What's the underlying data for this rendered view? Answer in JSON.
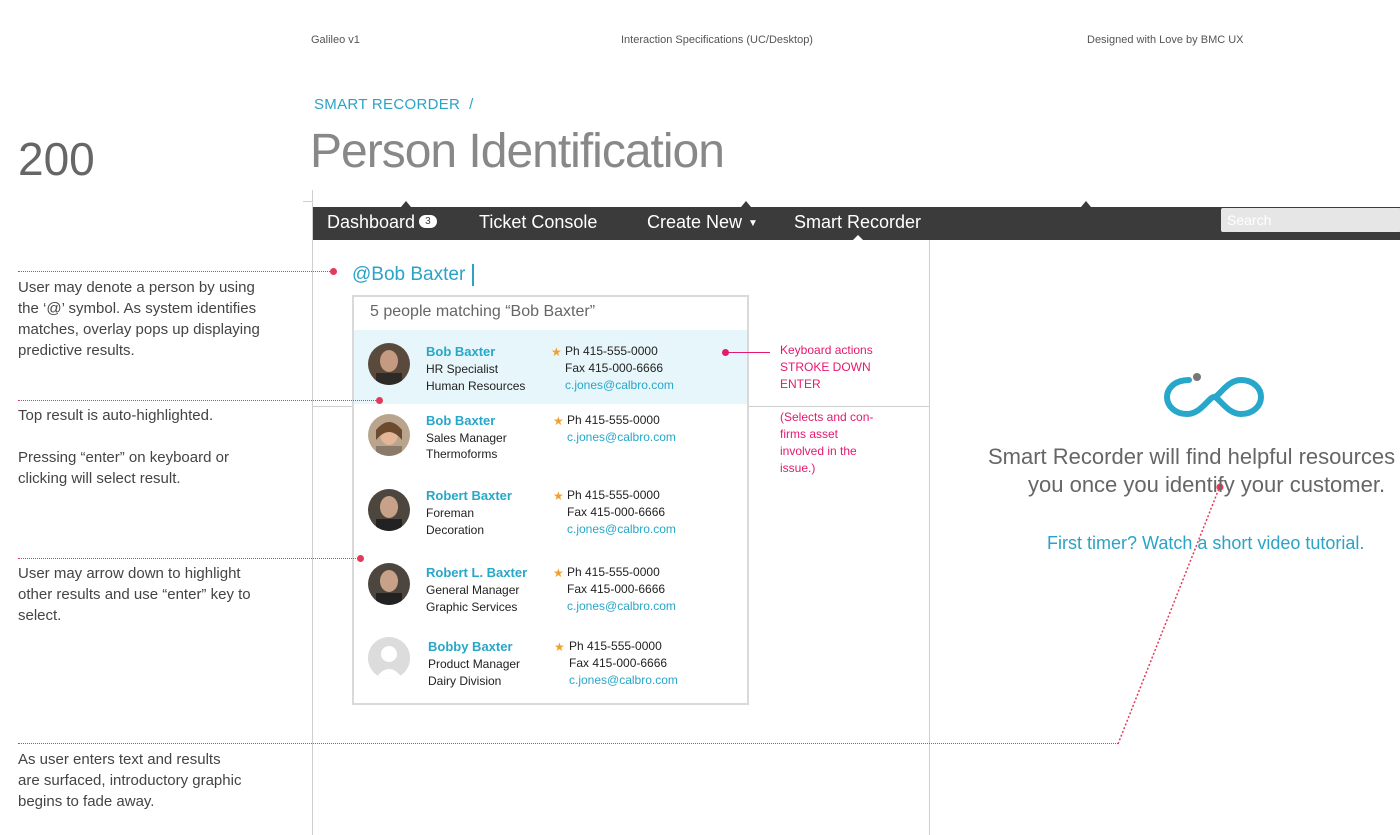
{
  "header": {
    "left": "Galileo v1",
    "center": "Interaction Specifications (UC/Desktop)",
    "right": "Designed with Love by BMC UX"
  },
  "breadcrumb": "SMART RECORDER  /",
  "page_title": "Person Identification",
  "page_number": "200",
  "nav": {
    "dashboard": "Dashboard",
    "dashboard_badge": "3",
    "ticket_console": "Ticket Console",
    "create_new": "Create New",
    "smart_recorder": "Smart Recorder",
    "search_placeholder": "Search"
  },
  "query": "@Bob Baxter",
  "overlay": {
    "heading": "5 people matching “Bob Baxter”",
    "results": [
      {
        "name": "Bob Baxter",
        "title": "HR Specialist",
        "dept": "Human Resources",
        "phone": "Ph 415-555-0000",
        "fax": "Fax 415-000-6666",
        "email": "c.jones@calbro.com"
      },
      {
        "name": "Bob Baxter",
        "title": "Sales Manager",
        "dept": "Thermoforms",
        "phone": "Ph 415-555-0000",
        "fax": "",
        "email": "c.jones@calbro.com"
      },
      {
        "name": "Robert Baxter",
        "title": "Foreman",
        "dept": "Decoration",
        "phone": "Ph 415-555-0000",
        "fax": "Fax 415-000-6666",
        "email": "c.jones@calbro.com"
      },
      {
        "name": "Robert L. Baxter",
        "title": "General Manager",
        "dept": "Graphic Services",
        "phone": "Ph 415-555-0000",
        "fax": "Fax 415-000-6666",
        "email": "c.jones@calbro.com"
      },
      {
        "name": "Bobby Baxter",
        "title": "Product Manager",
        "dept": "Dairy Division",
        "phone": "Ph 415-555-0000",
        "fax": "Fax 415-000-6666",
        "email": "c.jones@calbro.com"
      }
    ]
  },
  "annotations": {
    "a1": [
      "User may denote a person by using",
      "the ‘@’ symbol. As system identifies",
      "matches, overlay pops up displaying",
      "predictive results."
    ],
    "a2": [
      "Top result is auto-highlighted.",
      "",
      "Pressing “enter” on keyboard or",
      "clicking will select result."
    ],
    "a3": [
      "User may arrow down to highlight",
      "other results and use “enter” key to",
      "select."
    ],
    "a4": [
      "As user enters text and results",
      "are surfaced, introductory graphic",
      "begins to fade away."
    ],
    "keyboard": [
      "Keyboard actions",
      "STROKE DOWN",
      "ENTER"
    ],
    "selects": [
      "(Selects and con-",
      "firms asset",
      "involved in the",
      "issue.)"
    ]
  },
  "smart_recorder_panel": {
    "line1": "Smart Recorder will find helpful resources",
    "line2": "you once you identify your customer.",
    "link": "First timer? Watch a short video tutorial."
  },
  "colors": {
    "accent": "#2aa3c6",
    "nav": "#3b3b3b",
    "annotation": "#e23a5a",
    "highlight": "#e7f6fa"
  }
}
